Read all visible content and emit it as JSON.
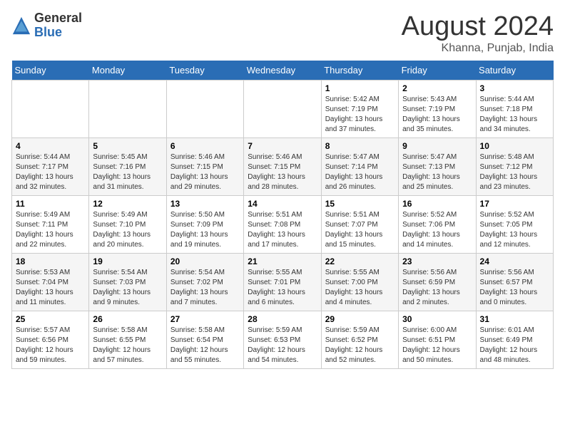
{
  "header": {
    "logo_general": "General",
    "logo_blue": "Blue",
    "month_title": "August 2024",
    "location": "Khanna, Punjab, India"
  },
  "weekdays": [
    "Sunday",
    "Monday",
    "Tuesday",
    "Wednesday",
    "Thursday",
    "Friday",
    "Saturday"
  ],
  "weeks": [
    [
      {
        "day": "",
        "sunrise": "",
        "sunset": "",
        "daylight": ""
      },
      {
        "day": "",
        "sunrise": "",
        "sunset": "",
        "daylight": ""
      },
      {
        "day": "",
        "sunrise": "",
        "sunset": "",
        "daylight": ""
      },
      {
        "day": "",
        "sunrise": "",
        "sunset": "",
        "daylight": ""
      },
      {
        "day": "1",
        "sunrise": "Sunrise: 5:42 AM",
        "sunset": "Sunset: 7:19 PM",
        "daylight": "Daylight: 13 hours and 37 minutes."
      },
      {
        "day": "2",
        "sunrise": "Sunrise: 5:43 AM",
        "sunset": "Sunset: 7:19 PM",
        "daylight": "Daylight: 13 hours and 35 minutes."
      },
      {
        "day": "3",
        "sunrise": "Sunrise: 5:44 AM",
        "sunset": "Sunset: 7:18 PM",
        "daylight": "Daylight: 13 hours and 34 minutes."
      }
    ],
    [
      {
        "day": "4",
        "sunrise": "Sunrise: 5:44 AM",
        "sunset": "Sunset: 7:17 PM",
        "daylight": "Daylight: 13 hours and 32 minutes."
      },
      {
        "day": "5",
        "sunrise": "Sunrise: 5:45 AM",
        "sunset": "Sunset: 7:16 PM",
        "daylight": "Daylight: 13 hours and 31 minutes."
      },
      {
        "day": "6",
        "sunrise": "Sunrise: 5:46 AM",
        "sunset": "Sunset: 7:15 PM",
        "daylight": "Daylight: 13 hours and 29 minutes."
      },
      {
        "day": "7",
        "sunrise": "Sunrise: 5:46 AM",
        "sunset": "Sunset: 7:15 PM",
        "daylight": "Daylight: 13 hours and 28 minutes."
      },
      {
        "day": "8",
        "sunrise": "Sunrise: 5:47 AM",
        "sunset": "Sunset: 7:14 PM",
        "daylight": "Daylight: 13 hours and 26 minutes."
      },
      {
        "day": "9",
        "sunrise": "Sunrise: 5:47 AM",
        "sunset": "Sunset: 7:13 PM",
        "daylight": "Daylight: 13 hours and 25 minutes."
      },
      {
        "day": "10",
        "sunrise": "Sunrise: 5:48 AM",
        "sunset": "Sunset: 7:12 PM",
        "daylight": "Daylight: 13 hours and 23 minutes."
      }
    ],
    [
      {
        "day": "11",
        "sunrise": "Sunrise: 5:49 AM",
        "sunset": "Sunset: 7:11 PM",
        "daylight": "Daylight: 13 hours and 22 minutes."
      },
      {
        "day": "12",
        "sunrise": "Sunrise: 5:49 AM",
        "sunset": "Sunset: 7:10 PM",
        "daylight": "Daylight: 13 hours and 20 minutes."
      },
      {
        "day": "13",
        "sunrise": "Sunrise: 5:50 AM",
        "sunset": "Sunset: 7:09 PM",
        "daylight": "Daylight: 13 hours and 19 minutes."
      },
      {
        "day": "14",
        "sunrise": "Sunrise: 5:51 AM",
        "sunset": "Sunset: 7:08 PM",
        "daylight": "Daylight: 13 hours and 17 minutes."
      },
      {
        "day": "15",
        "sunrise": "Sunrise: 5:51 AM",
        "sunset": "Sunset: 7:07 PM",
        "daylight": "Daylight: 13 hours and 15 minutes."
      },
      {
        "day": "16",
        "sunrise": "Sunrise: 5:52 AM",
        "sunset": "Sunset: 7:06 PM",
        "daylight": "Daylight: 13 hours and 14 minutes."
      },
      {
        "day": "17",
        "sunrise": "Sunrise: 5:52 AM",
        "sunset": "Sunset: 7:05 PM",
        "daylight": "Daylight: 13 hours and 12 minutes."
      }
    ],
    [
      {
        "day": "18",
        "sunrise": "Sunrise: 5:53 AM",
        "sunset": "Sunset: 7:04 PM",
        "daylight": "Daylight: 13 hours and 11 minutes."
      },
      {
        "day": "19",
        "sunrise": "Sunrise: 5:54 AM",
        "sunset": "Sunset: 7:03 PM",
        "daylight": "Daylight: 13 hours and 9 minutes."
      },
      {
        "day": "20",
        "sunrise": "Sunrise: 5:54 AM",
        "sunset": "Sunset: 7:02 PM",
        "daylight": "Daylight: 13 hours and 7 minutes."
      },
      {
        "day": "21",
        "sunrise": "Sunrise: 5:55 AM",
        "sunset": "Sunset: 7:01 PM",
        "daylight": "Daylight: 13 hours and 6 minutes."
      },
      {
        "day": "22",
        "sunrise": "Sunrise: 5:55 AM",
        "sunset": "Sunset: 7:00 PM",
        "daylight": "Daylight: 13 hours and 4 minutes."
      },
      {
        "day": "23",
        "sunrise": "Sunrise: 5:56 AM",
        "sunset": "Sunset: 6:59 PM",
        "daylight": "Daylight: 13 hours and 2 minutes."
      },
      {
        "day": "24",
        "sunrise": "Sunrise: 5:56 AM",
        "sunset": "Sunset: 6:57 PM",
        "daylight": "Daylight: 13 hours and 0 minutes."
      }
    ],
    [
      {
        "day": "25",
        "sunrise": "Sunrise: 5:57 AM",
        "sunset": "Sunset: 6:56 PM",
        "daylight": "Daylight: 12 hours and 59 minutes."
      },
      {
        "day": "26",
        "sunrise": "Sunrise: 5:58 AM",
        "sunset": "Sunset: 6:55 PM",
        "daylight": "Daylight: 12 hours and 57 minutes."
      },
      {
        "day": "27",
        "sunrise": "Sunrise: 5:58 AM",
        "sunset": "Sunset: 6:54 PM",
        "daylight": "Daylight: 12 hours and 55 minutes."
      },
      {
        "day": "28",
        "sunrise": "Sunrise: 5:59 AM",
        "sunset": "Sunset: 6:53 PM",
        "daylight": "Daylight: 12 hours and 54 minutes."
      },
      {
        "day": "29",
        "sunrise": "Sunrise: 5:59 AM",
        "sunset": "Sunset: 6:52 PM",
        "daylight": "Daylight: 12 hours and 52 minutes."
      },
      {
        "day": "30",
        "sunrise": "Sunrise: 6:00 AM",
        "sunset": "Sunset: 6:51 PM",
        "daylight": "Daylight: 12 hours and 50 minutes."
      },
      {
        "day": "31",
        "sunrise": "Sunrise: 6:01 AM",
        "sunset": "Sunset: 6:49 PM",
        "daylight": "Daylight: 12 hours and 48 minutes."
      }
    ]
  ]
}
